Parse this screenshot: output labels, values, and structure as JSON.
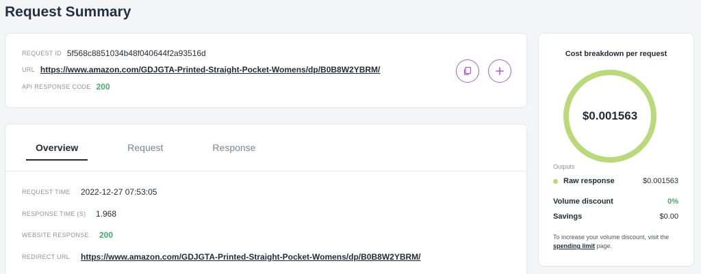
{
  "page": {
    "title": "Request Summary"
  },
  "summary": {
    "request_id_label": "REQUEST ID",
    "request_id": "5f568c8851034b48f040644f2a93516d",
    "url_label": "URL",
    "url": "https://www.amazon.com/GDJGTA-Printed-Straight-Pocket-Womens/dp/B0B8W2YBRM/",
    "api_code_label": "API RESPONSE CODE",
    "api_code": "200",
    "copy_icon": "copy-icon",
    "add_icon": "plus-icon",
    "accent_color": "#b05bcf"
  },
  "tabs": [
    {
      "label": "Overview",
      "active": true
    },
    {
      "label": "Request",
      "active": false
    },
    {
      "label": "Response",
      "active": false
    }
  ],
  "overview": {
    "request_time_label": "REQUEST TIME",
    "request_time": "2022-12-27 07:53:05",
    "response_time_label": "RESPONSE TIME (S)",
    "response_time": "1.968",
    "website_response_label": "WEBSITE RESPONSE",
    "website_response": "200",
    "redirect_url_label": "REDIRECT URL",
    "redirect_url": "https://www.amazon.com/GDJGTA-Printed-Straight-Pocket-Womens/dp/B0B8W2YBRM/"
  },
  "cost": {
    "title": "Cost breakdown per request",
    "total": "$0.001563",
    "ring_color": "#bada7a",
    "outputs_label": "Outputs",
    "raw_label": "Raw response",
    "raw_value": "$0.001563",
    "volume_label": "Volume discount",
    "volume_value": "0%",
    "savings_label": "Savings",
    "savings_value": "$0.00",
    "note_before": "To increase your volume discount, visit the ",
    "note_link": "spending limit",
    "note_after": " page."
  }
}
